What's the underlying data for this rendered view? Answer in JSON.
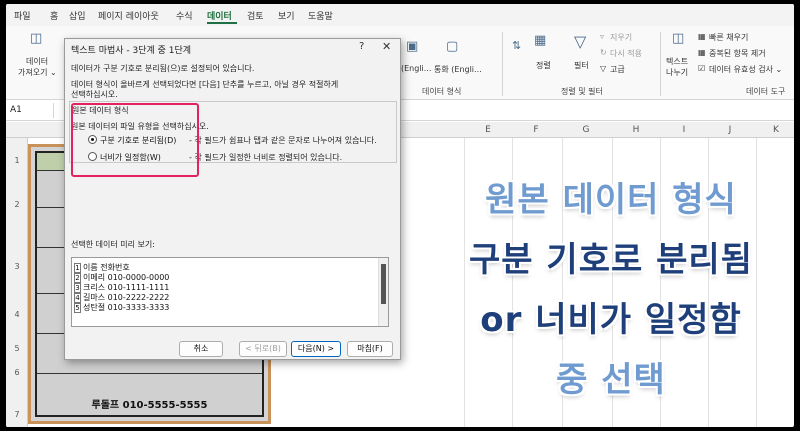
{
  "menu": {
    "tabs": [
      "파일",
      "홈",
      "삽입",
      "페이지 레이아웃",
      "수식",
      "데이터",
      "검토",
      "보기",
      "도움말"
    ],
    "active_tab": "데이터"
  },
  "ribbon": {
    "get_data_line1": "데이터",
    "get_data_line2": "가져오기 ⌄",
    "stocks_label": "(Engli...",
    "currency_label": "통화 (Engli...",
    "datatypes_group": "데이터 형식",
    "sort_label": "정렬",
    "filter_label": "필터",
    "clear_label": "지우기",
    "reapply_label": "다시 적용",
    "advanced_label": "고급",
    "sortfilter_group": "정렬 및 필터",
    "text_to_columns_line1": "텍스트",
    "text_to_columns_line2": "나누기",
    "flash_fill_label": "빠른 채우기",
    "remove_dup_label": "중복된 항목 제거",
    "validation_label": "데이터 유효성 검사 ⌄",
    "datatools_group": "데이터 도구"
  },
  "formula": {
    "name_box": "A1"
  },
  "grid": {
    "columns": [
      "E",
      "F",
      "G",
      "H",
      "I",
      "J",
      "K"
    ],
    "rows": [
      "1",
      "2",
      "3",
      "4",
      "5",
      "6",
      "7"
    ],
    "last_entry": "루돌프 010-5555-5555"
  },
  "dialog": {
    "title": "텍스트 마법사 - 3단계 중 1단계",
    "help": "?",
    "close": "✕",
    "intro1": "데이터가 구분 기호로 분리됨(으)로 설정되어 있습니다.",
    "intro2": "데이터 형식이 올바르게 선택되었다면 [다음] 단추를 누르고, 아닐 경우 적절하게",
    "intro3": "선택하십시오.",
    "group_legend": "원본 데이터 형식",
    "choose_prompt": "원본 데이터의 파일 유형을 선택하십시오.",
    "option_delimited": "구분 기호로 분리됨(D)",
    "option_delimited_desc": "- 각 필드가 쉼표나 탭과 같은 문자로 나누어져 있습니다.",
    "option_fixed": "너비가 일정함(W)",
    "option_fixed_desc": "- 각 필드가 일정한 너비로 정렬되어 있습니다.",
    "preview_label": "선택한 데이터 미리 보기:",
    "preview_rows": [
      {
        "num": "1",
        "text": "이름 전화번호"
      },
      {
        "num": "2",
        "text": "이메리 010-0000-0000"
      },
      {
        "num": "3",
        "text": "크리스 010-1111-1111"
      },
      {
        "num": "4",
        "text": "길마스 010-2222-2222"
      },
      {
        "num": "5",
        "text": "성탄절 010-3333-3333"
      }
    ],
    "btn_cancel": "취소",
    "btn_back": "< 뒤로(B)",
    "btn_next": "다음(N) >",
    "btn_finish": "마침(F)"
  },
  "caption": {
    "line1": "원본 데이터 형식",
    "line2": "구분 기호로 분리됨",
    "line3": "or 너비가 일정함",
    "line4": "중 선택"
  },
  "colors": {
    "accent_green": "#1e7145",
    "highlight_pink": "#e0245e",
    "caption_light": "#6f9bd0",
    "caption_dark": "#1e3f7a"
  }
}
